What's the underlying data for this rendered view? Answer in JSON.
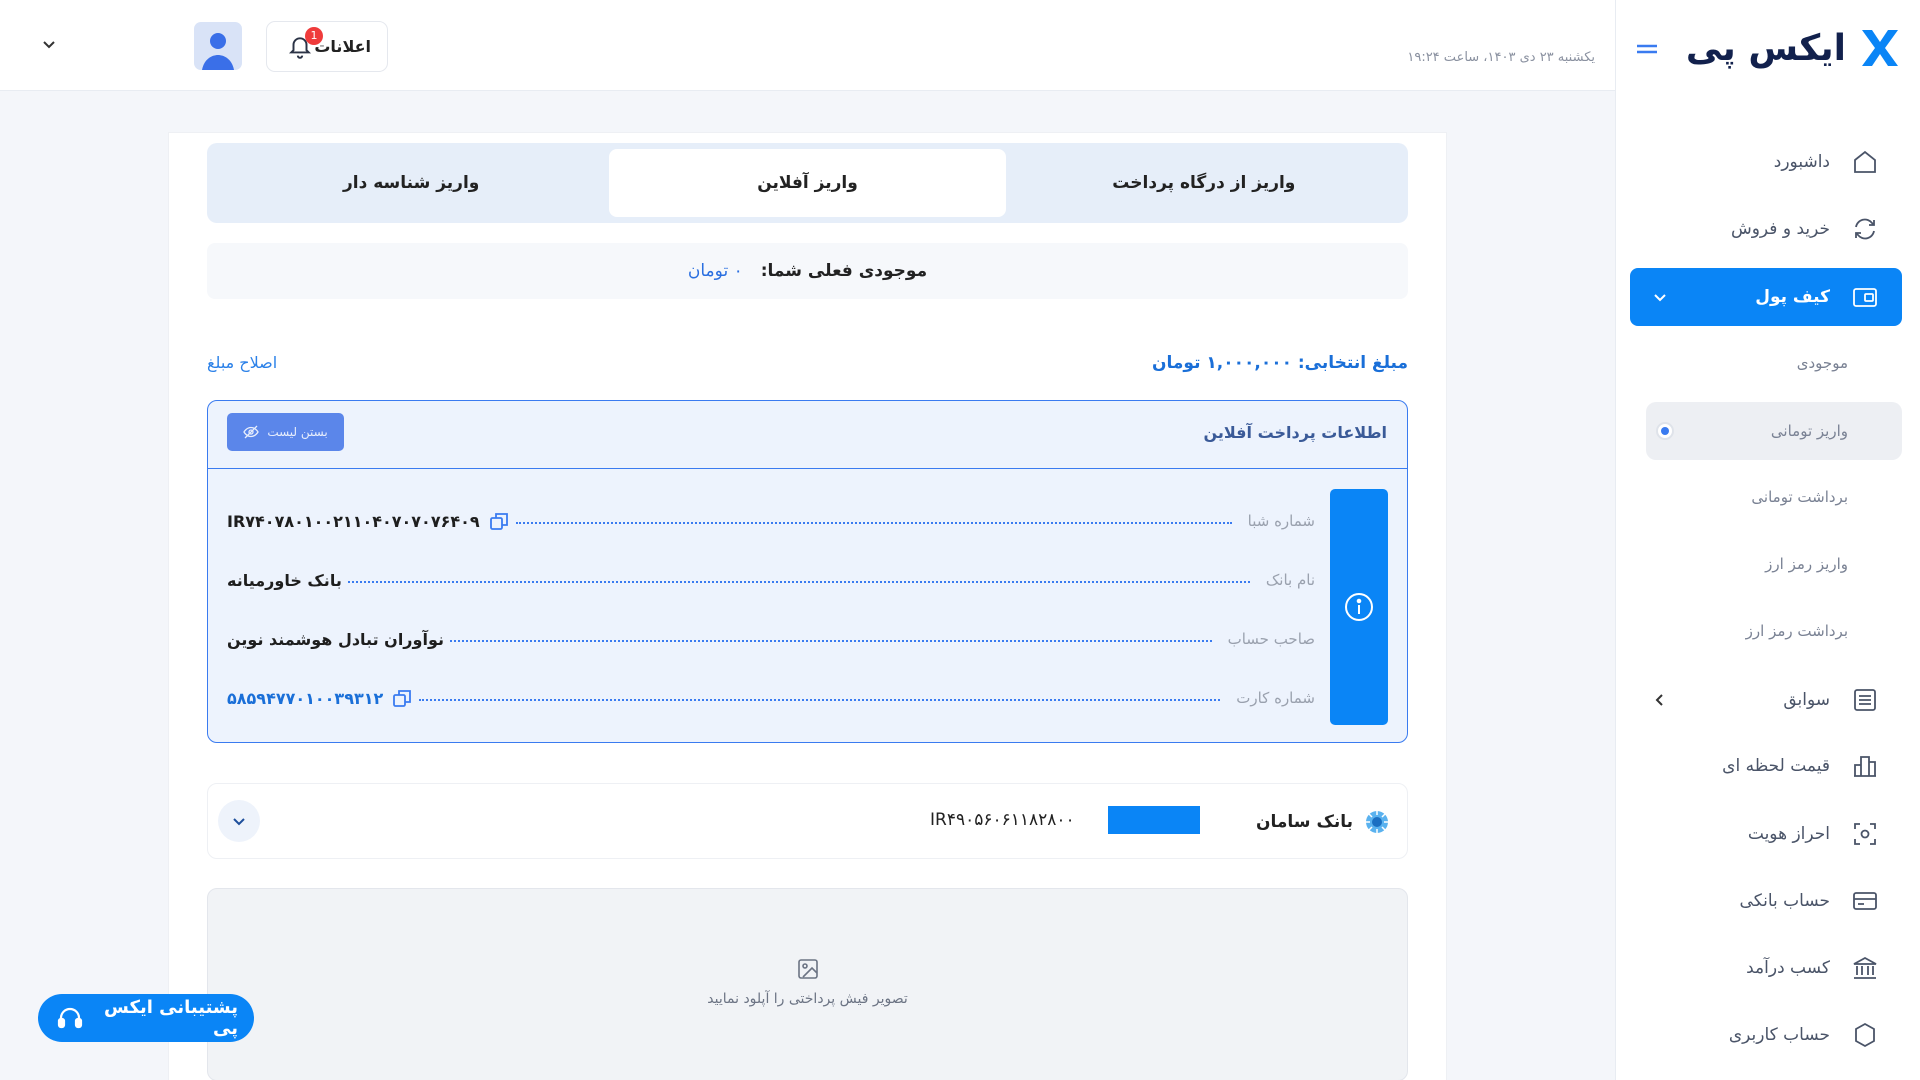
{
  "brand": {
    "name": "ایکس پی",
    "accent": "#0a85f6"
  },
  "header": {
    "datetime": "یکشنبه ۲۳ دی ۱۴۰۳، ساعت ۱۹:۲۴",
    "notifications_label": "اعلانات",
    "notifications_count": "1"
  },
  "sidebar": {
    "items": [
      {
        "label": "داشبورد",
        "icon": "home-icon"
      },
      {
        "label": "خرید و فروش",
        "icon": "refresh-icon"
      },
      {
        "label": "کیف پول",
        "icon": "wallet-icon"
      },
      {
        "label": "سوابق",
        "icon": "list-icon"
      },
      {
        "label": "قیمت لحظه ای",
        "icon": "chart-icon"
      },
      {
        "label": "احراز هویت",
        "icon": "face-scan-icon"
      },
      {
        "label": "حساب بانکی",
        "icon": "card-icon"
      },
      {
        "label": "کسب درآمد",
        "icon": "bank-icon"
      },
      {
        "label": "حساب کاربری",
        "icon": "gear-icon"
      }
    ],
    "wallet_sub": [
      "موجودی",
      "واریز تومانی",
      "برداشت تومانی",
      "واریز رمز ارز",
      "برداشت رمز ارز"
    ]
  },
  "tabs": [
    "واریز از درگاه پرداخت",
    "واریز آفلاین",
    "واریز شناسه دار"
  ],
  "balance": {
    "label": "موجودی فعلی شما:",
    "value": "۰ تومان"
  },
  "amount": {
    "selected": "مبلغ انتخابی: ۱,۰۰۰,۰۰۰ تومان",
    "fix": "اصلاح مبلغ"
  },
  "offline": {
    "title": "اطلاعات پرداخت آفلاین",
    "close_label": "بستن لیست",
    "rows": [
      {
        "key": "شماره شبا",
        "value": "IR۷۴۰۷۸۰۱۰۰۲۱۱۰۴۰۷۰۷۰۷۶۴۰۹"
      },
      {
        "key": "نام بانک",
        "value": "بانک خاورمیانه"
      },
      {
        "key": "صاحب حساب",
        "value": "نوآوران تبادل هوشمند نوین"
      },
      {
        "key": "شماره کارت",
        "value": "۵۸۵۹۴۷۷۰۱۰۰۳۹۳۱۲"
      }
    ]
  },
  "bank": {
    "name": "بانک سامان",
    "iban_partial": "IR۴۹۰۵۶۰۶۱۱۸۲۸۰۰"
  },
  "upload": {
    "text": "تصویر فیش پرداختی را آپلود نمایید"
  },
  "support": {
    "label": "پشتیبانی ایکس پی"
  }
}
